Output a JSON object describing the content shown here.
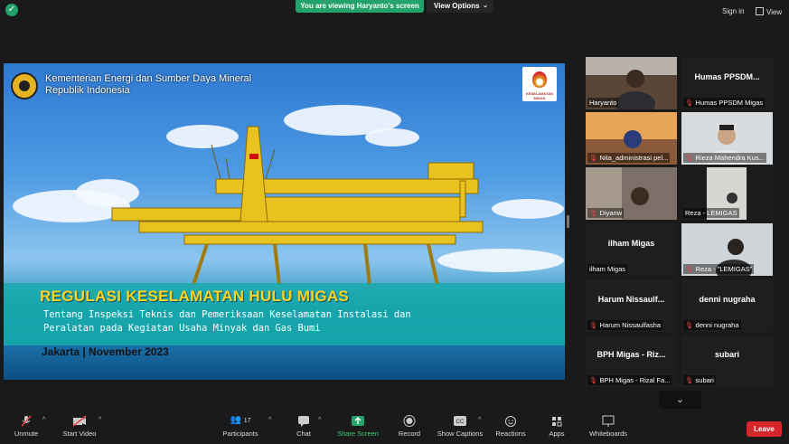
{
  "topbar": {
    "viewing": "You are viewing Haryanto's screen",
    "view_options": "View Options",
    "sign_in": "Sign in",
    "view": "View"
  },
  "slide": {
    "ministry_line1": "Kementerian Energi dan Sumber Daya Mineral",
    "ministry_line2": "Republik Indonesia",
    "logo_label": "KESELAMATAN MIGAS",
    "title": "REGULASI KESELAMATAN HULU MIGAS",
    "subtitle_line1": "Tentang Inspeksi Teknis dan Pemeriksaan Keselamatan Instalasi dan",
    "subtitle_line2": "Peralatan pada Kegiatan Usaha Minyak dan Gas Bumi",
    "date": "Jakarta |   November 2023"
  },
  "gallery": [
    {
      "big": "",
      "name": "Haryanto",
      "muted": false
    },
    {
      "big": "Humas  PPSDM...",
      "name": "Humas PPSDM Migas",
      "muted": true
    },
    {
      "big": "",
      "name": "Nita_administrasi pel...",
      "muted": true
    },
    {
      "big": "",
      "name": "Rieza Mahendra Kus...",
      "muted": true
    },
    {
      "big": "",
      "name": "Diyanw",
      "muted": true
    },
    {
      "big": "",
      "name": "Reza - LEMIGAS",
      "muted": false
    },
    {
      "big": "ilham Migas",
      "name": "ilham Migas",
      "muted": false
    },
    {
      "big": "",
      "name": "Reza - \"LEMIGAS\"",
      "muted": true
    },
    {
      "big": "Harum  Nissaulf...",
      "name": "Harum Nissaulfasha",
      "muted": true
    },
    {
      "big": "denni nugraha",
      "name": "denni nugraha",
      "muted": true
    },
    {
      "big": "BPH Migas - Riz...",
      "name": "BPH Migas - Rizal Fa...",
      "muted": true
    },
    {
      "big": "subari",
      "name": "subari",
      "muted": true
    }
  ],
  "toolbar": {
    "unmute": "Unmute",
    "start_video": "Start Video",
    "participants": "Participants",
    "participants_count": "17",
    "chat": "Chat",
    "share_screen": "Share Screen",
    "record": "Record",
    "show_captions": "Show Captions",
    "reactions": "Reactions",
    "apps": "Apps",
    "whiteboards": "Whiteboards",
    "leave": "Leave"
  },
  "colors": {
    "accent_green": "#23a36b",
    "leave_red": "#d7262b",
    "active_speaker": "#c8d24a",
    "slide_title": "#ffd21f"
  }
}
